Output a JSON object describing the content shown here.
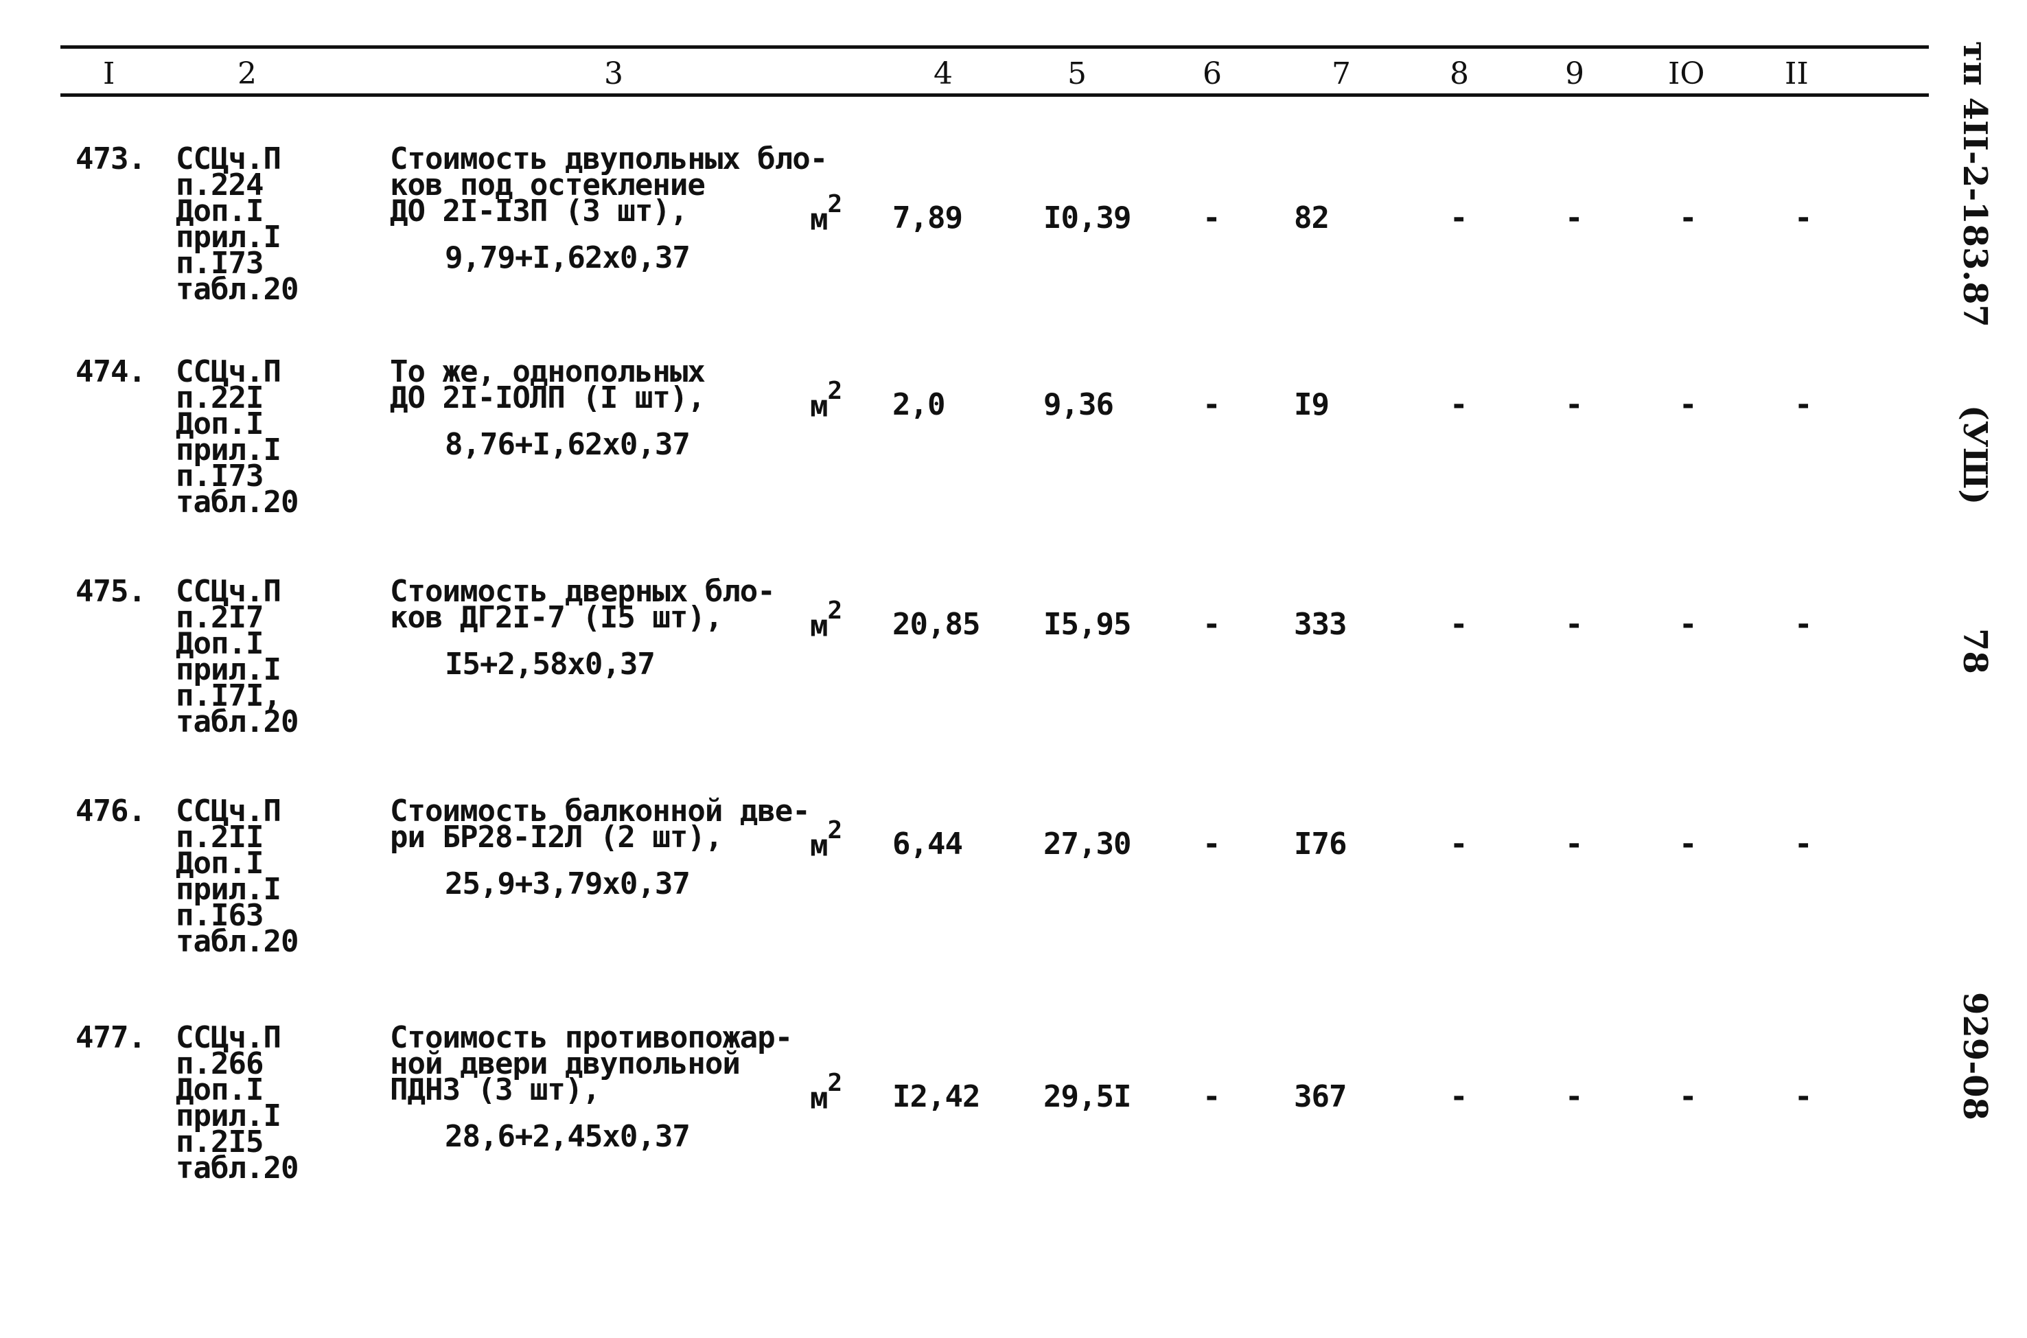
{
  "header": {
    "columns": [
      "I",
      "2",
      "3",
      "4",
      "5",
      "6",
      "7",
      "8",
      "9",
      "IO",
      "II"
    ]
  },
  "margin": {
    "doc_code": "тп 4II-2-183.87",
    "volume": "(УШ)",
    "page_number": "78",
    "sheet_code": "929-08"
  },
  "rows": [
    {
      "num": "473.",
      "ref": [
        "ССЦч.П",
        "п.224",
        "Доп.I",
        "прил.I",
        "п.I73",
        "табл.20"
      ],
      "desc": [
        "Стоимость двупольных бло-",
        "ков под остекление",
        "ДО 2I-I3П (3 шт),"
      ],
      "unit": "м",
      "unit_sup": "2",
      "formula": "9,79+I,62x0,37",
      "c4": "7,89",
      "c5": "I0,39",
      "c6": "-",
      "c7": "82",
      "c8": "-",
      "c9": "-",
      "c10": "-",
      "c11": "-"
    },
    {
      "num": "474.",
      "ref": [
        "ССЦч.П",
        "п.22I",
        "Доп.I",
        "прил.I",
        "п.I73",
        "табл.20"
      ],
      "desc": [
        "То же, однопольных",
        "ДО 2I-IОЛП (I шт),"
      ],
      "unit": "м",
      "unit_sup": "2",
      "formula": "8,76+I,62x0,37",
      "c4": "2,0",
      "c5": "9,36",
      "c6": "-",
      "c7": "I9",
      "c8": "-",
      "c9": "-",
      "c10": "-",
      "c11": "-"
    },
    {
      "num": "475.",
      "ref": [
        "ССЦч.П",
        "п.2I7",
        "Доп.I",
        "прил.I",
        "п.I7I,",
        "табл.20"
      ],
      "desc": [
        "Стоимость дверных бло-",
        "ков ДГ2I-7 (I5 шт),"
      ],
      "unit": "м",
      "unit_sup": "2",
      "formula": "I5+2,58x0,37",
      "c4": "20,85",
      "c5": "I5,95",
      "c6": "-",
      "c7": "333",
      "c8": "-",
      "c9": "-",
      "c10": "-",
      "c11": "-"
    },
    {
      "num": "476.",
      "ref": [
        "ССЦч.П",
        "п.2II",
        "Доп.I",
        "прил.I",
        "п.I63",
        "табл.20"
      ],
      "desc": [
        "Стоимость балконной две-",
        "ри БР28-I2Л (2 шт),"
      ],
      "unit": "м",
      "unit_sup": "2",
      "formula": "25,9+3,79x0,37",
      "c4": "6,44",
      "c5": "27,30",
      "c6": "-",
      "c7": "I76",
      "c8": "-",
      "c9": "-",
      "c10": "-",
      "c11": "-"
    },
    {
      "num": "477.",
      "ref": [
        "ССЦч.П",
        "п.266",
        "Доп.I",
        "прил.I",
        "п.2I5",
        "табл.20"
      ],
      "desc": [
        "Стоимость противопожар-",
        "ной двери двупольной",
        "ПДНЗ (3 шт),"
      ],
      "unit": "м",
      "unit_sup": "2",
      "formula": "28,6+2,45x0,37",
      "c4": "I2,42",
      "c5": "29,5I",
      "c6": "-",
      "c7": "367",
      "c8": "-",
      "c9": "-",
      "c10": "-",
      "c11": "-"
    }
  ]
}
